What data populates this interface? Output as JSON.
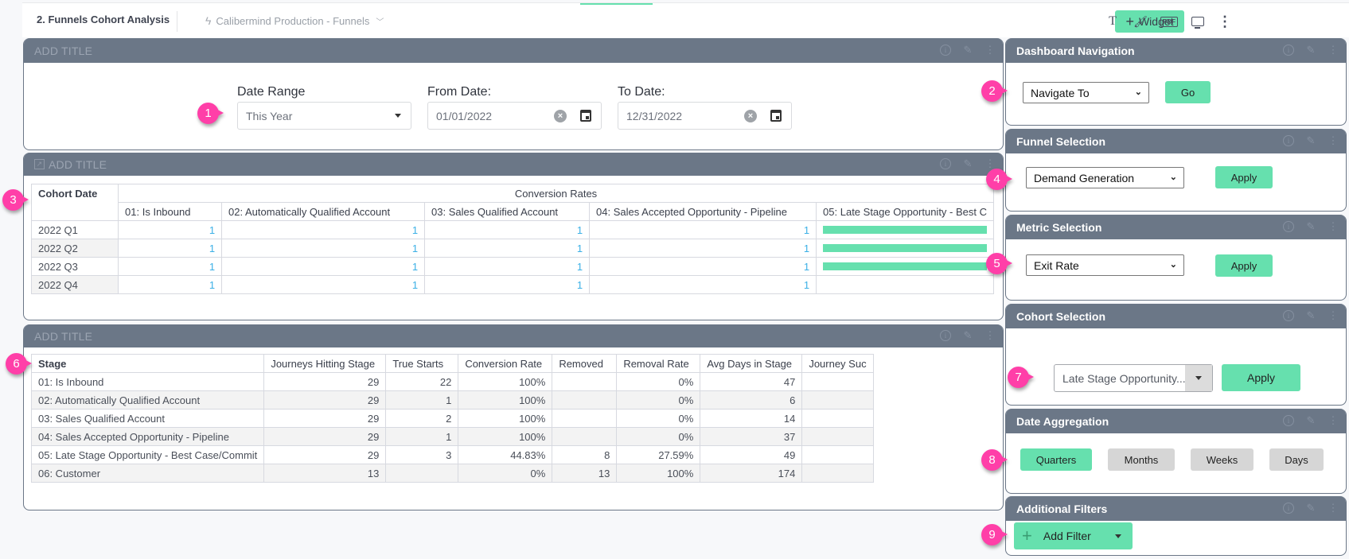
{
  "header": {
    "dashboard_title": "2. Funnels Cohort Analysis",
    "datasource": "Calibermind Production - Funnels",
    "widget_button": "Widget",
    "icons": [
      "text-icon",
      "brush-icon",
      "pdf-icon",
      "monitor-icon",
      "more-vert-icon"
    ],
    "pdf_label": "PDF"
  },
  "placeholder_title": "ADD TITLE",
  "date_filter": {
    "date_range_label": "Date Range",
    "date_range_value": "This Year",
    "from_label": "From Date:",
    "from_value": "01/01/2022",
    "to_label": "To Date:",
    "to_value": "12/31/2022"
  },
  "cohort_table": {
    "corner_header": "Cohort Date",
    "group_header": "Conversion Rates",
    "columns": [
      "01: Is Inbound",
      "02: Automatically Qualified Account",
      "03: Sales Qualified Account",
      "04: Sales Accepted Opportunity - Pipeline",
      "05: Late Stage Opportunity - Best C"
    ],
    "rows": [
      {
        "label": "2022 Q1",
        "values": [
          "1",
          "1",
          "1",
          "1"
        ],
        "bar_fill": 1
      },
      {
        "label": "2022 Q2",
        "values": [
          "1",
          "1",
          "1",
          "1"
        ],
        "bar_fill": 1
      },
      {
        "label": "2022 Q3",
        "values": [
          "1",
          "1",
          "1",
          "1"
        ],
        "bar_fill": 1
      },
      {
        "label": "2022 Q4",
        "values": [
          "1",
          "1",
          "1",
          "1"
        ],
        "bar_fill": 0
      }
    ]
  },
  "stage_table": {
    "columns": [
      "Stage",
      "Journeys Hitting Stage",
      "True Starts",
      "Conversion Rate",
      "Removed",
      "Removal Rate",
      "Avg Days in Stage",
      "Journey Suc"
    ],
    "rows": [
      [
        "01: Is Inbound",
        "29",
        "22",
        "100%",
        "",
        "0%",
        "47",
        ""
      ],
      [
        "02: Automatically Qualified Account",
        "29",
        "1",
        "100%",
        "",
        "0%",
        "6",
        ""
      ],
      [
        "03: Sales Qualified Account",
        "29",
        "2",
        "100%",
        "",
        "0%",
        "14",
        ""
      ],
      [
        "04: Sales Accepted Opportunity - Pipeline",
        "29",
        "1",
        "100%",
        "",
        "0%",
        "37",
        ""
      ],
      [
        "05: Late Stage Opportunity - Best Case/Commit",
        "29",
        "3",
        "44.83%",
        "8",
        "27.59%",
        "49",
        ""
      ],
      [
        "06: Customer",
        "13",
        "",
        "0%",
        "13",
        "100%",
        "174",
        ""
      ]
    ]
  },
  "right_panel": {
    "dashboard_nav": {
      "title": "Dashboard Navigation",
      "select_value": "Navigate To",
      "button": "Go"
    },
    "funnel_selection": {
      "title": "Funnel Selection",
      "select_value": "Demand Generation",
      "button": "Apply"
    },
    "metric_selection": {
      "title": "Metric Selection",
      "select_value": "Exit Rate",
      "button": "Apply"
    },
    "cohort_selection": {
      "title": "Cohort Selection",
      "select_value": "Late Stage Opportunity...",
      "button": "Apply"
    },
    "date_aggregation": {
      "title": "Date Aggregation",
      "options": [
        "Quarters",
        "Months",
        "Weeks",
        "Days"
      ],
      "selected": "Quarters"
    },
    "additional_filters": {
      "title": "Additional Filters",
      "button": "Add Filter"
    }
  },
  "callouts": [
    "1",
    "2",
    "3",
    "4",
    "5",
    "6",
    "7",
    "8",
    "9"
  ],
  "colors": {
    "accent": "#66e0ae",
    "header_bg": "#6b7787",
    "callout": "#ff3fa8",
    "link_blue": "#3bb0e6"
  }
}
